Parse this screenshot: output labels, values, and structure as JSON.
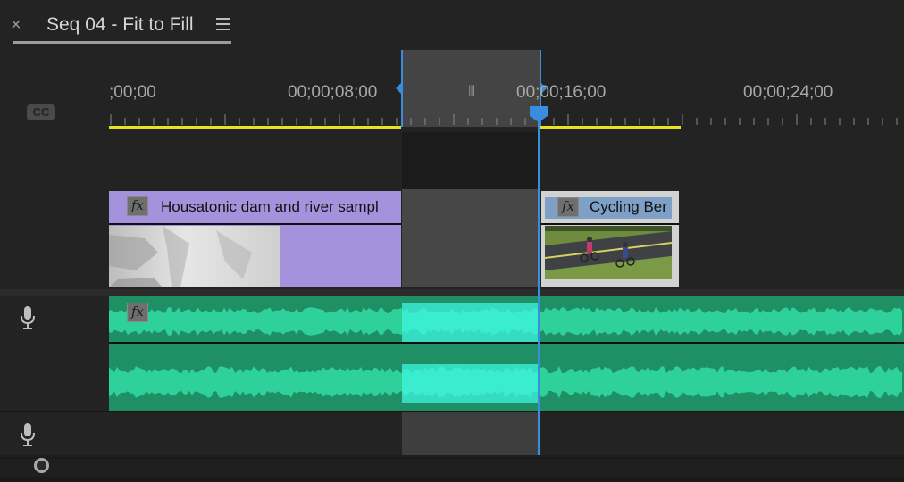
{
  "panel": {
    "close_label": "×",
    "sequence_tab": "Seq 04 - Fit to Fill"
  },
  "ruler": {
    "cc_label": "CC",
    "timecodes": [
      ";00;00",
      "00;00;08;00",
      "00;00;16;00",
      "00;00;24;00"
    ]
  },
  "clips": {
    "video": [
      {
        "name": "Housatonic dam and river sampl",
        "fx": "fx",
        "color": "#a592dc"
      },
      {
        "name": "Cycling Ber",
        "fx": "fx",
        "color": "#7fa0c6"
      }
    ],
    "audio": {
      "fx": "fx",
      "color": "#2fd19a",
      "highlight_color": "#3ff5e0"
    }
  },
  "icons": {
    "close": "close-icon",
    "menu": "hamburger-menu-icon",
    "cc": "closed-captions-icon",
    "mic": "microphone-icon",
    "playhead": "playhead-icon"
  },
  "colors": {
    "accent": "#3a8dde",
    "render_bar": "#e8e221"
  }
}
